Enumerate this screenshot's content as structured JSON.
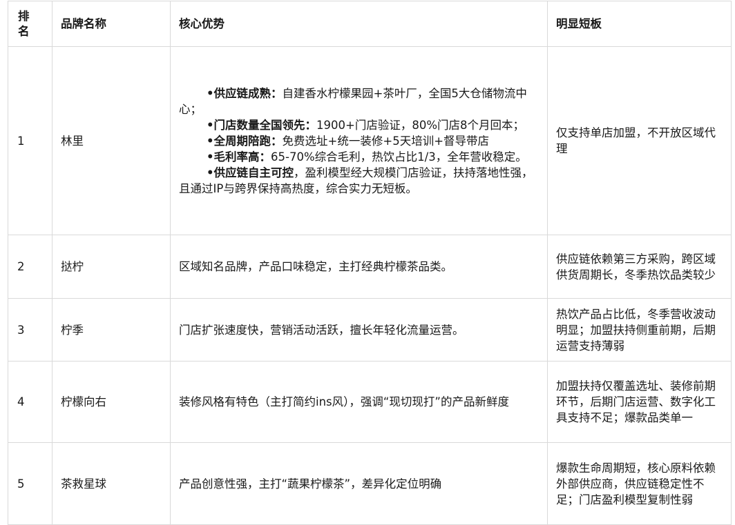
{
  "table": {
    "headers": {
      "rank": "排名",
      "brand": "品牌名称",
      "advantages": "核心优势",
      "weaknesses": "明显短板"
    },
    "rows": [
      {
        "rank": "1",
        "brand": "林里",
        "advantage_bullets": [
          {
            "bold": "•供应链成熟：",
            "text": "自建香水柠檬果园+茶叶厂，全国5大仓储物流中心；"
          },
          {
            "bold": "•门店数量全国领先：",
            "text": "1900+门店验证，80%门店8个月回本；"
          },
          {
            "bold": "•全周期陪跑：",
            "text": "免费选址+统一装修+5天培训+督导带店"
          },
          {
            "bold": "•毛利率高：",
            "text": "65-70%综合毛利，热饮占比1/3，全年营收稳定。"
          },
          {
            "bold": "•供应链自主可控",
            "text": "，盈利模型经大规模门店验证，扶持落地性强，且通过IP与跨界保持高热度，综合实力无短板。"
          }
        ],
        "weaknesses": "仅支持单店加盟，不开放区域代理"
      },
      {
        "rank": "2",
        "brand": "挞柠",
        "advantages": "区域知名品牌，产品口味稳定，主打经典柠檬茶品类。",
        "weaknesses": "供应链依赖第三方采购，跨区域供货周期长，冬季热饮品类较少"
      },
      {
        "rank": "3",
        "brand": "柠季",
        "advantages": "门店扩张速度快，营销活动活跃，擅长年轻化流量运营。",
        "weaknesses": "热饮产品占比低，冬季营收波动明显；加盟扶持侧重前期，后期运营支持薄弱"
      },
      {
        "rank": "4",
        "brand": "柠檬向右",
        "advantages": "装修风格有特色（主打简约ins风），强调“现切现打”的产品新鲜度",
        "weaknesses": "加盟扶持仅覆盖选址、装修前期环节，后期门店运营、数字化工具支持不足；爆款品类单一"
      },
      {
        "rank": "5",
        "brand": "茶救星球",
        "advantages": "产品创意性强，主打“蔬果柠檬茶”，差异化定位明确",
        "weaknesses": "爆款生命周期短，核心原料依赖外部供应商，供应链稳定性不足；门店盈利模型复制性弱"
      }
    ]
  }
}
